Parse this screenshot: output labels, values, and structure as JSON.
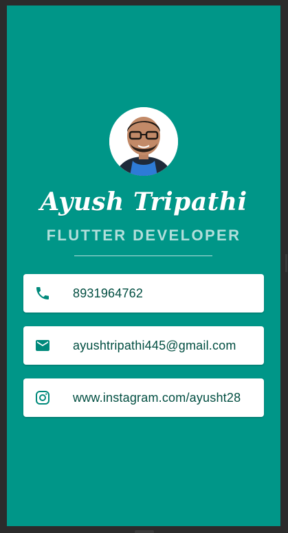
{
  "colors": {
    "background": "#009688",
    "accent_text": "#b2dfdb",
    "icon": "#00897b",
    "card_text": "#004d40"
  },
  "profile": {
    "name": "Ayush Tripathi",
    "role": "FLUTTER DEVELOPER"
  },
  "contacts": [
    {
      "icon": "phone-icon",
      "value": "8931964762"
    },
    {
      "icon": "email-icon",
      "value": "ayushtripathi445@gmail.com"
    },
    {
      "icon": "instagram-icon",
      "value": "www.instagram.com/ayusht28"
    }
  ]
}
